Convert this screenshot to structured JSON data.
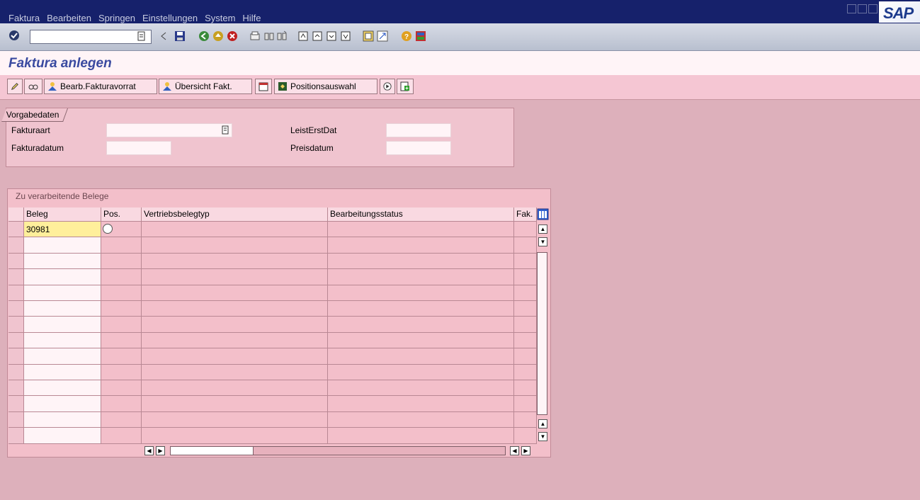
{
  "menu": {
    "items": [
      "Faktura",
      "Bearbeiten",
      "Springen",
      "Einstellungen",
      "System",
      "Hilfe"
    ]
  },
  "logo_text": "SAP",
  "title": "Faktura anlegen",
  "app_toolbar": {
    "bearb_fakturavorrat": "Bearb.Fakturavorrat",
    "uebersicht_fakt": "Übersicht Fakt.",
    "positionsauswahl": "Positionsauswahl"
  },
  "vorgabedaten": {
    "tab_label": "Vorgabedaten",
    "fakturaart_label": "Fakturaart",
    "fakturaart_value": "",
    "fakturadatum_label": "Fakturadatum",
    "fakturadatum_value": "",
    "leisterstdat_label": "LeistErstDat",
    "leisterstdat_value": "",
    "preisdatum_label": "Preisdatum",
    "preisdatum_value": ""
  },
  "belege_table": {
    "title": "Zu verarbeitende Belege",
    "columns": [
      "Beleg",
      "Pos.",
      "Vertriebsbelegtyp",
      "Bearbeitungsstatus",
      "Fak."
    ],
    "rows": [
      [
        "30981",
        "",
        "",
        "",
        ""
      ],
      [
        "",
        "",
        "",
        "",
        ""
      ],
      [
        "",
        "",
        "",
        "",
        ""
      ],
      [
        "",
        "",
        "",
        "",
        ""
      ],
      [
        "",
        "",
        "",
        "",
        ""
      ],
      [
        "",
        "",
        "",
        "",
        ""
      ],
      [
        "",
        "",
        "",
        "",
        ""
      ],
      [
        "",
        "",
        "",
        "",
        ""
      ],
      [
        "",
        "",
        "",
        "",
        ""
      ],
      [
        "",
        "",
        "",
        "",
        ""
      ],
      [
        "",
        "",
        "",
        "",
        ""
      ],
      [
        "",
        "",
        "",
        "",
        ""
      ],
      [
        "",
        "",
        "",
        "",
        ""
      ],
      [
        "",
        "",
        "",
        "",
        ""
      ]
    ]
  },
  "colors": {
    "background": "#ddb0bb",
    "menubar": "#16216b",
    "title_text": "#3a4aa0",
    "highlight_cell": "#ffef9b"
  }
}
